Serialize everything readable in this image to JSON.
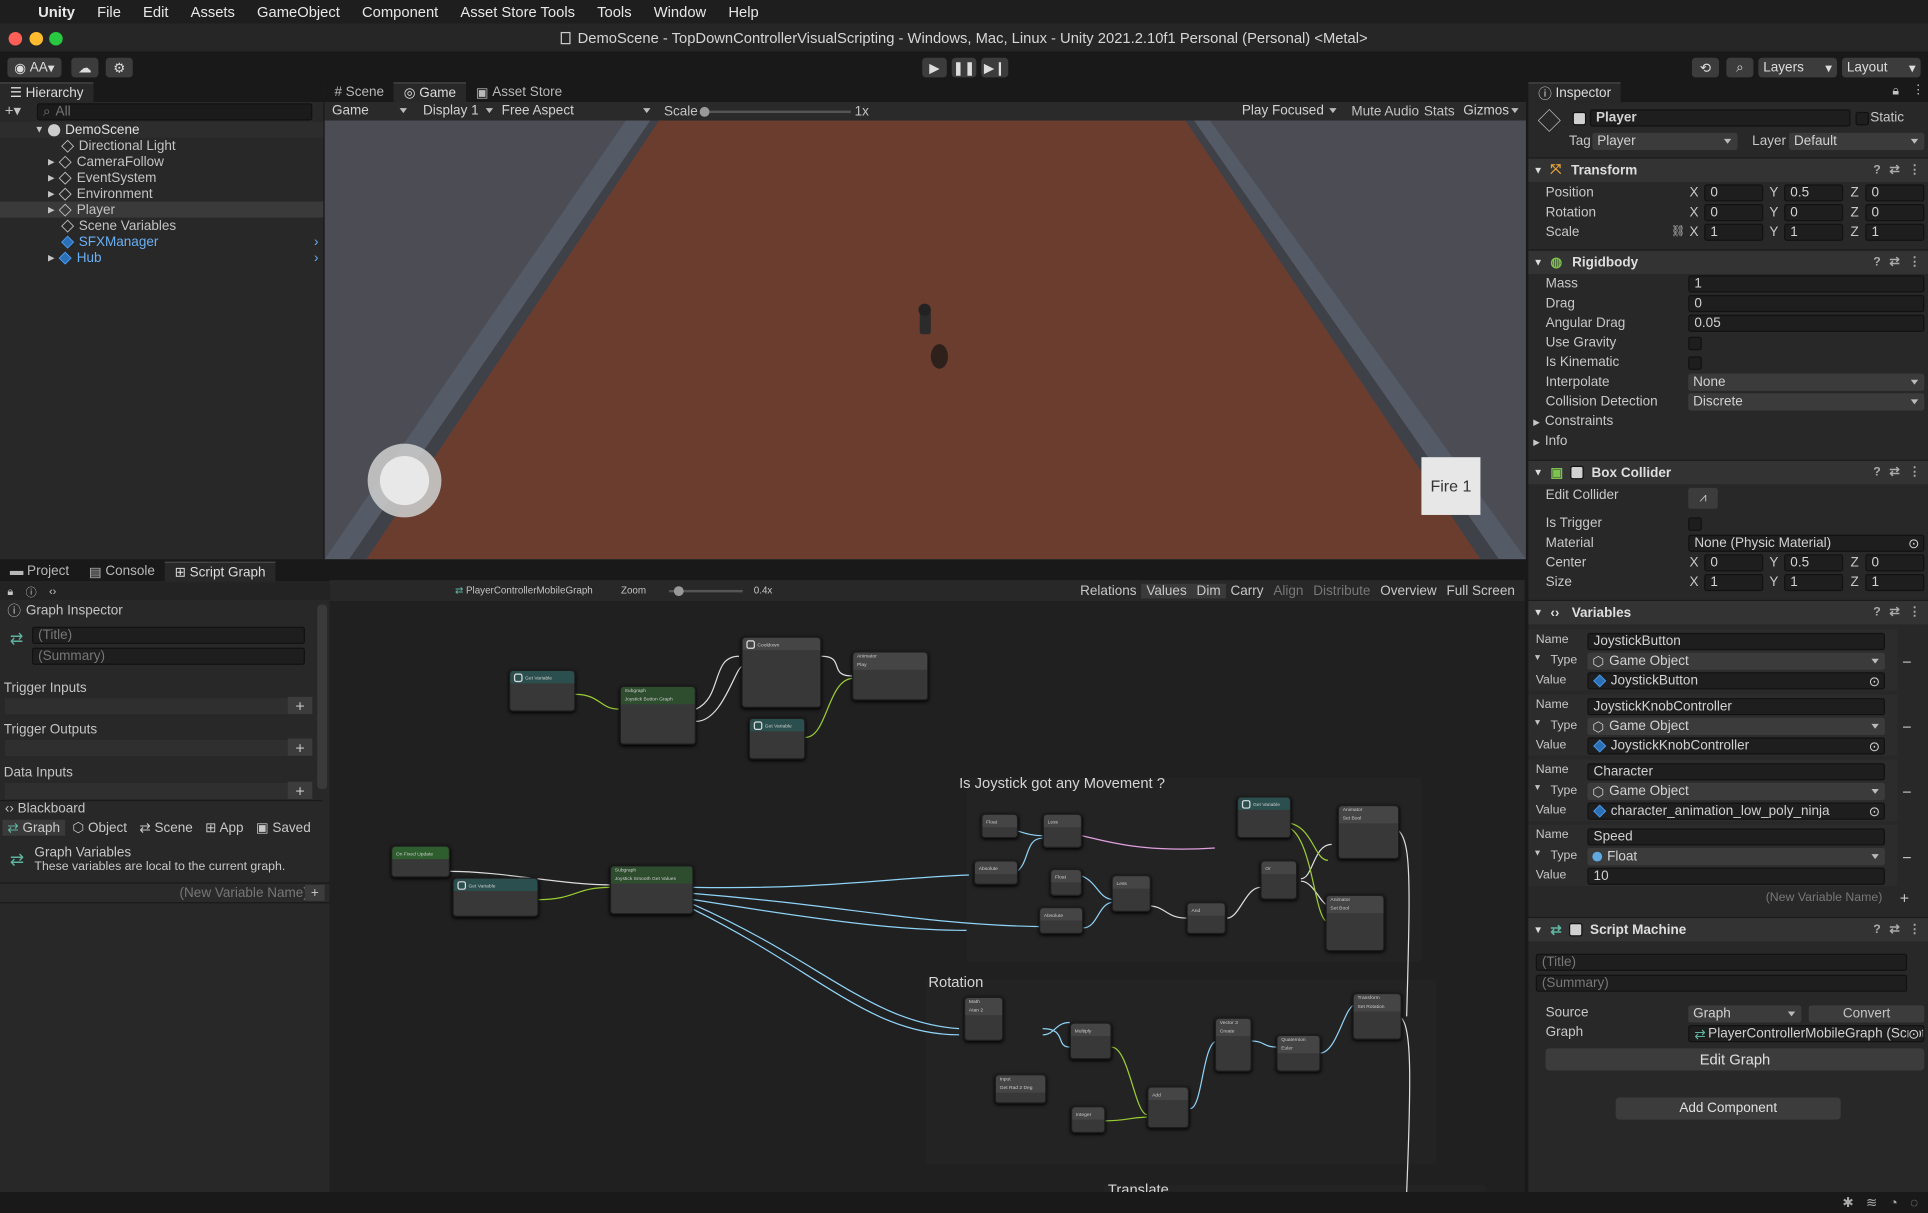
{
  "menubar": {
    "app": "Unity",
    "items": [
      "File",
      "Edit",
      "Assets",
      "GameObject",
      "Component",
      "Asset Store Tools",
      "Tools",
      "Window",
      "Help"
    ]
  },
  "window": {
    "title": "DemoScene - TopDownControllerVisualScripting - Windows, Mac, Linux - Unity 2021.2.10f1 Personal (Personal) <Metal>"
  },
  "toolbar": {
    "account": "AA",
    "layers": "Layers",
    "layout": "Layout"
  },
  "hierarchy": {
    "tab": "Hierarchy",
    "search_placeholder": "All",
    "scene": "DemoScene",
    "items": [
      "Directional Light",
      "CameraFollow",
      "EventSystem",
      "Environment",
      "Player",
      "Scene Variables",
      "SFXManager",
      "Hub"
    ]
  },
  "scene_tabs": {
    "scene": "Scene",
    "game": "Game",
    "asset_store": "Asset Store"
  },
  "game_bar": {
    "game": "Game",
    "display": "Display 1",
    "aspect": "Free Aspect",
    "scale": "Scale",
    "scale_value": "1x",
    "play_focused": "Play Focused",
    "mute": "Mute Audio",
    "stats": "Stats",
    "gizmos": "Gizmos"
  },
  "game_view": {
    "fire_button": "Fire 1",
    "colors": {
      "floor": "#6b3d2e",
      "wall": "#545b66",
      "sky": "#4c4d54"
    }
  },
  "bottom_tabs": {
    "project": "Project",
    "console": "Console",
    "script_graph": "Script Graph"
  },
  "graph_toolbar": {
    "graph_name": "PlayerControllerMobileGraph",
    "zoom_label": "Zoom",
    "zoom_value": "0.4x",
    "buttons": [
      "Relations",
      "Values",
      "Dim",
      "Carry",
      "Align",
      "Distribute",
      "Overview",
      "Full Screen"
    ]
  },
  "graph_inspector": {
    "header": "Graph Inspector",
    "title_placeholder": "(Title)",
    "summary_placeholder": "(Summary)",
    "trigger_inputs": "Trigger Inputs",
    "trigger_outputs": "Trigger Outputs",
    "data_inputs": "Data Inputs"
  },
  "blackboard": {
    "header": "Blackboard",
    "tabs": [
      "Graph",
      "Object",
      "Scene",
      "App",
      "Saved"
    ],
    "section_title": "Graph Variables",
    "section_desc": "These variables are local to the current graph.",
    "new_var_placeholder": "(New Variable Name)"
  },
  "graph_groups": {
    "joystick": "Is Joystick got any Movement ?",
    "rotation": "Rotation",
    "translate": "Translate"
  },
  "graph_nodes": [
    "Get Variable",
    "Subgraph",
    "Joystick Button Graph",
    "Cooldown",
    "Animator",
    "Play",
    "Get Variable",
    "On Fixed Update",
    "Get Variable",
    "Subgraph",
    "Joystick Smooth Get Values",
    "Float",
    "Less",
    "Absolute",
    "Float",
    "Less",
    "Absolute",
    "Get Variable",
    "Animator",
    "Set Bool",
    "And",
    "Or",
    "Animator",
    "Set Bool",
    "Math",
    "Atan 2",
    "Multiply",
    "Add",
    "Input",
    "Get Rad 2 Deg",
    "Integer",
    "Vector 3",
    "Create",
    "Quaternion",
    "Euler",
    "Transform",
    "Set Rotation"
  ],
  "inspector": {
    "tab": "Inspector",
    "object_name": "Player",
    "static_label": "Static",
    "tag_label": "Tag",
    "tag": "Player",
    "layer_label": "Layer",
    "layer": "Default",
    "transform": {
      "title": "Transform",
      "position_label": "Position",
      "position": [
        "0",
        "0.5",
        "0"
      ],
      "rotation_label": "Rotation",
      "rotation": [
        "0",
        "0",
        "0"
      ],
      "scale_label": "Scale",
      "scale": [
        "1",
        "1",
        "1"
      ]
    },
    "rigidbody": {
      "title": "Rigidbody",
      "mass_label": "Mass",
      "mass": "1",
      "drag_label": "Drag",
      "drag": "0",
      "angular_drag_label": "Angular Drag",
      "angular_drag": "0.05",
      "use_gravity_label": "Use Gravity",
      "is_kinematic_label": "Is Kinematic",
      "interpolate_label": "Interpolate",
      "interpolate": "None",
      "collision_label": "Collision Detection",
      "collision": "Discrete",
      "constraints_label": "Constraints",
      "info_label": "Info"
    },
    "box_collider": {
      "title": "Box Collider",
      "edit_collider_label": "Edit Collider",
      "is_trigger_label": "Is Trigger",
      "material_label": "Material",
      "material": "None (Physic Material)",
      "center_label": "Center",
      "center": [
        "0",
        "0.5",
        "0"
      ],
      "size_label": "Size",
      "size": [
        "1",
        "1",
        "1"
      ]
    },
    "variables": {
      "title": "Variables",
      "name_label": "Name",
      "type_label": "Type",
      "value_label": "Value",
      "items": [
        {
          "name": "JoystickButton",
          "type": "Game Object",
          "value": "JoystickButton"
        },
        {
          "name": "JoystickKnobController",
          "type": "Game Object",
          "value": "JoystickKnobController"
        },
        {
          "name": "Character",
          "type": "Game Object",
          "value": "character_animation_low_poly_ninja"
        },
        {
          "name": "Speed",
          "type": "Float",
          "value": "10"
        }
      ],
      "new_var_placeholder": "(New Variable Name)"
    },
    "script_machine": {
      "title": "Script Machine",
      "title_placeholder": "(Title)",
      "summary_placeholder": "(Summary)",
      "source_label": "Source",
      "source": "Graph",
      "convert": "Convert",
      "graph_label": "Graph",
      "graph": "PlayerControllerMobileGraph (Script",
      "edit_graph": "Edit Graph"
    },
    "add_component": "Add Component"
  }
}
